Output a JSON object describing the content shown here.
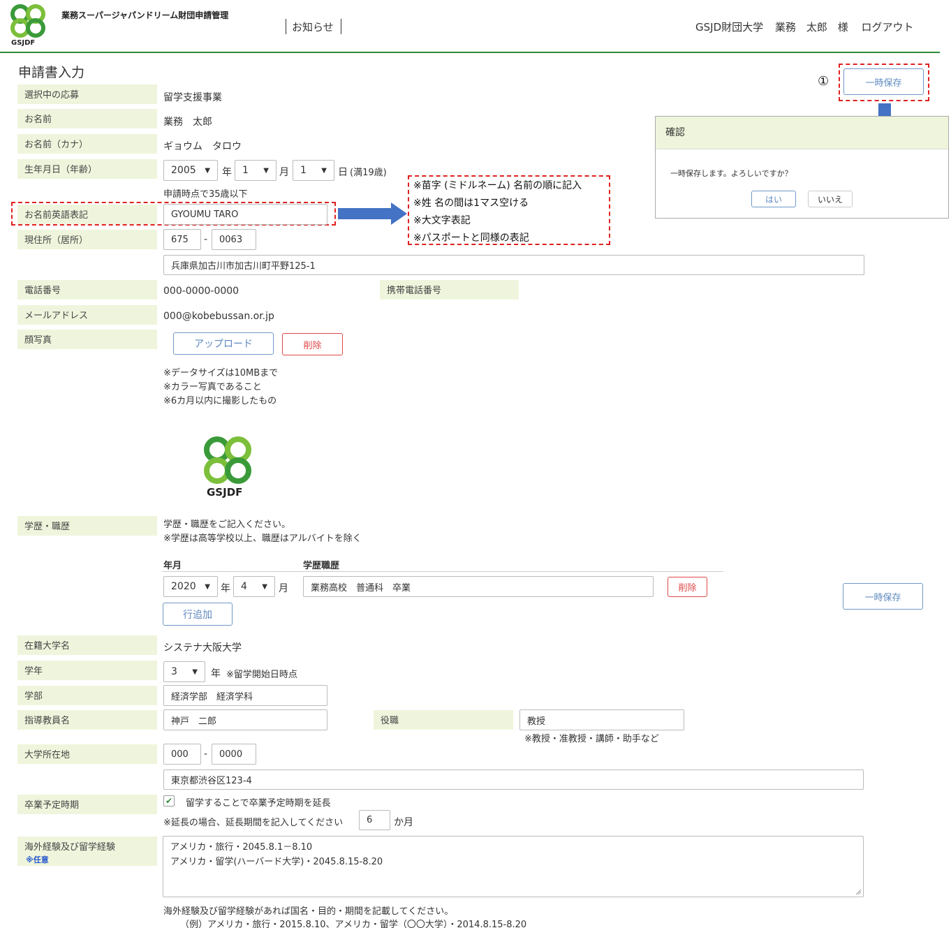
{
  "header": {
    "logo_text": "GSJDF",
    "app_title": "業務スーパージャパンドリーム財団申請管理",
    "nav_notice": "お知らせ",
    "org": "GSJD財団大学",
    "user_name": "業務　太郎",
    "user_suffix": "様",
    "logout": "ログアウト"
  },
  "page": {
    "title": "申請書入力",
    "marker": "①",
    "save_label": "一時保存"
  },
  "dialog": {
    "title": "確認",
    "message": "一時保存します。よろしいですか？",
    "yes": "はい",
    "no": "いいえ"
  },
  "callout": {
    "lines": [
      "※苗字 (ミドルネーム) 名前の順に記入",
      "※姓 名の間は1マス空ける",
      "※大文字表記",
      "※パスポートと同様の表記"
    ]
  },
  "form": {
    "program": {
      "label": "選択中の応募",
      "value": "留学支援事業"
    },
    "name": {
      "label": "お名前",
      "value": "業務　太郎"
    },
    "kana": {
      "label": "お名前（カナ）",
      "value": "ギョウム　タロウ"
    },
    "birth": {
      "label": "生年月日（年齢）",
      "year": "2005",
      "year_unit": "年",
      "month": "1",
      "month_unit": "月",
      "day": "1",
      "day_unit": "日",
      "age": "(満19歳)",
      "note": "申請時点で35歳以下"
    },
    "english_name": {
      "label": "お名前英語表記",
      "value": "GYOUMU TARO"
    },
    "address": {
      "label": "現住所（居所）",
      "zip1": "675",
      "dash": "-",
      "zip2": "0063",
      "value": "兵庫県加古川市加古川町平野125-1"
    },
    "phone": {
      "label": "電話番号",
      "value": "000-0000-0000",
      "mobile_label": "携帯電話番号"
    },
    "email": {
      "label": "メールアドレス",
      "value": "000@kobebussan.or.jp"
    },
    "photo": {
      "label": "顔写真",
      "upload": "アップロード",
      "delete": "削除",
      "notes": [
        "※データサイズは10MBまで",
        "※カラー写真であること",
        "※6カ月以内に撮影したもの"
      ],
      "image_text": "GSJDF"
    },
    "history": {
      "label": "学歴・職歴",
      "intro": [
        "学歴・職歴をご記入ください。",
        "※学歴は高等学校以上、職歴はアルバイトを除く"
      ],
      "col_date": "年月",
      "col_history": "学歴職歴",
      "year": "2020",
      "year_unit": "年",
      "month": "4",
      "month_unit": "月",
      "entry": "業務高校　普通科　卒業",
      "delete": "削除",
      "add_row": "行追加"
    },
    "university": {
      "label": "在籍大学名",
      "value": "システナ大阪大学"
    },
    "grade": {
      "label": "学年",
      "value": "3",
      "unit": "年",
      "note": "※留学開始日時点"
    },
    "faculty": {
      "label": "学部",
      "value": "経済学部　経済学科"
    },
    "advisor": {
      "label": "指導教員名",
      "value": "神戸　二郎",
      "title_label": "役職",
      "title_value": "教授",
      "title_note": "※教授・准教授・講師・助手など"
    },
    "univ_address": {
      "label": "大学所在地",
      "zip1": "000",
      "dash": "-",
      "zip2": "0000",
      "value": "東京都渋谷区123-4"
    },
    "graduation": {
      "label": "卒業予定時期",
      "checkbox_label": "留学することで卒業予定時期を延長",
      "extend_note": "※延長の場合、延長期間を記入してください",
      "months": "6",
      "months_unit": "か月"
    },
    "overseas": {
      "label": "海外経験及び留学経験",
      "optional": "※任意",
      "lines": [
        "アメリカ・旅行・2045.8.1－8.10",
        "アメリカ・留学(ハーバード大学)・2045.8.15-8.20"
      ],
      "help": "海外経験及び留学経験があれば国名・目的・期間を記載してください。",
      "example": "（例）アメリカ・旅行・2015.8.10、アメリカ・留学（〇〇大学）・2014.8.15-8.20"
    }
  },
  "colors": {
    "accent_green": "#2e8b3a",
    "label_bg": "#eef5dc",
    "button_blue": "#5d88bf",
    "button_red": "#e04848",
    "annotation_red": "#e02020",
    "arrow_blue": "#4472c4"
  }
}
